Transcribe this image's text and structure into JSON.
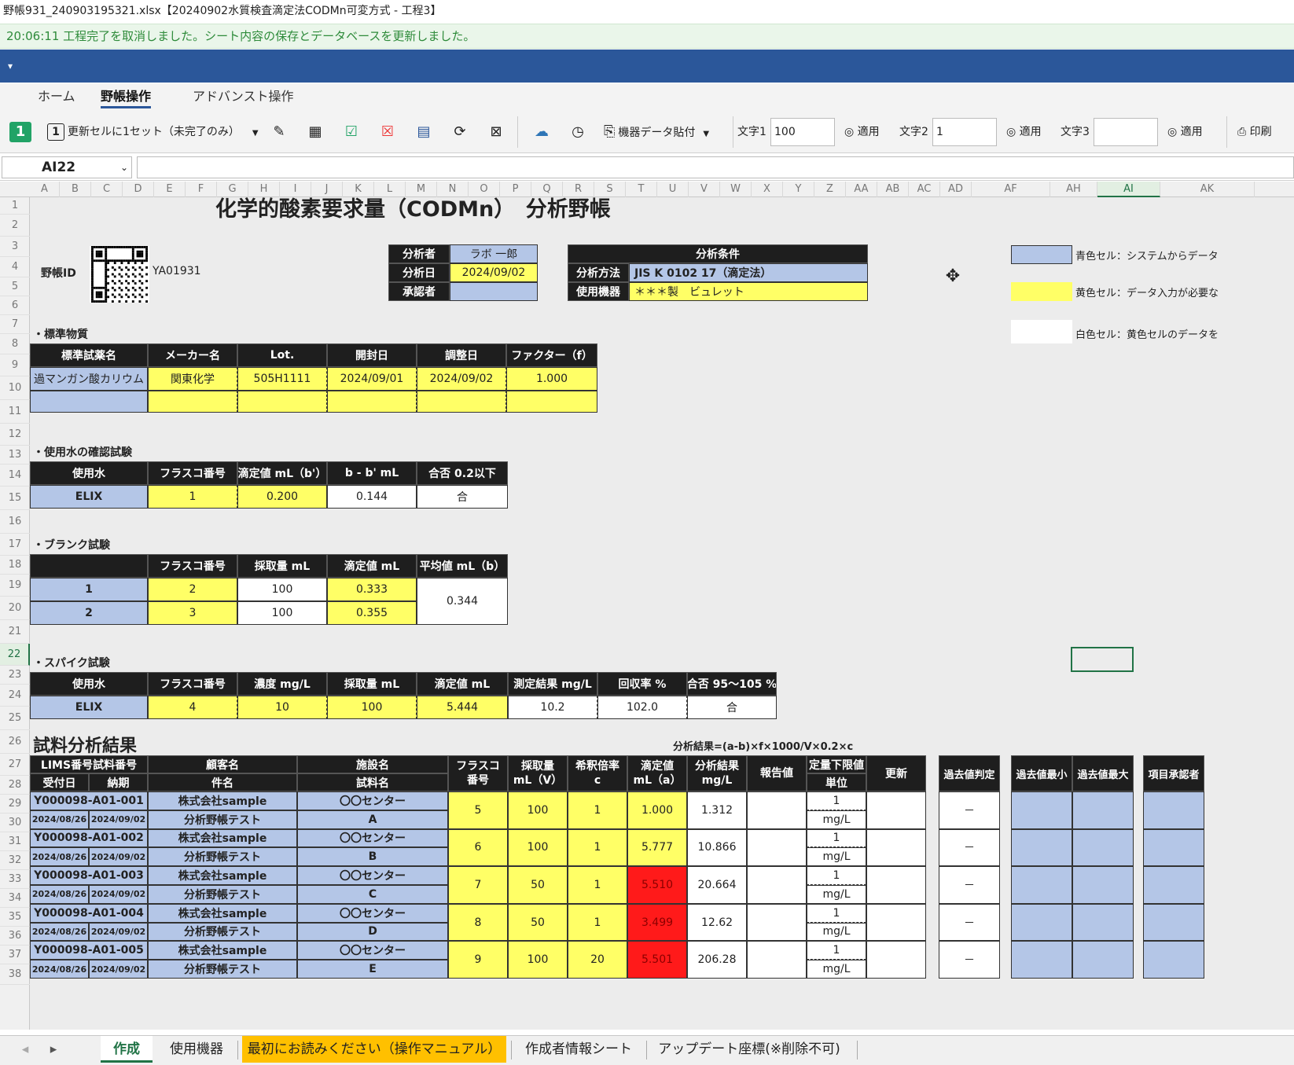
{
  "window": {
    "title": "野帳931_240903195321.xlsx【20240902水質検査滴定法CODMn可変方式 - 工程3】"
  },
  "message": "20:06:11 工程完了を取消しました。シート内容の保存とデータベースを更新しました。",
  "collapse_glyph": "▾",
  "ribbon": {
    "tabs": [
      "ホーム",
      "野帳操作",
      "アドバンスト操作"
    ]
  },
  "toolbar": {
    "counter": "1",
    "update_set": "更新セルに1セット（未完了のみ）",
    "device_paste": "機器データ貼付",
    "text1_label": "文字1",
    "text1_value": "100",
    "text2_label": "文字2",
    "text2_value": "1",
    "text3_label": "文字3",
    "text3_value": "",
    "apply": "適用",
    "print": "印刷"
  },
  "namebox": "AI22",
  "columns": [
    "A",
    "B",
    "C",
    "D",
    "E",
    "F",
    "G",
    "H",
    "I",
    "J",
    "K",
    "L",
    "M",
    "N",
    "O",
    "P",
    "Q",
    "R",
    "S",
    "T",
    "U",
    "V",
    "W",
    "X",
    "Y",
    "Z",
    "AA",
    "AB",
    "AC",
    "AD",
    "AF",
    "AH",
    "AI",
    "AK"
  ],
  "sheet": {
    "title": "化学的酸素要求量（CODMn）　分析野帳",
    "notebook_id_label": "野帳ID",
    "notebook_id": "YA01931",
    "analyst": {
      "label": "分析者",
      "value": "ラボ 一郎"
    },
    "date": {
      "label": "分析日",
      "value": "2024/09/02"
    },
    "approver": {
      "label": "承認者",
      "value": ""
    },
    "conditions": {
      "header": "分析条件",
      "method_label": "分析方法",
      "method": "JIS K 0102 17（滴定法）",
      "device_label": "使用機器",
      "device": "＊＊＊製　ビュレット"
    },
    "legend": [
      "青色セル：システムからデータ",
      "黄色セル：データ入力が必要な",
      "白色セル：黄色セルのデータを"
    ],
    "std": {
      "section": "・標準物質",
      "headers": [
        "標準試薬名",
        "メーカー名",
        "Lot.",
        "開封日",
        "調整日",
        "ファクター（f）"
      ],
      "row": [
        "過マンガン酸カリウム",
        "関東化学",
        "505H1111",
        "2024/09/01",
        "2024/09/02",
        "1.000"
      ]
    },
    "water": {
      "section": "・使用水の確認試験",
      "headers": [
        "使用水",
        "フラスコ番号",
        "滴定値 mL（b'）",
        "b - b' mL",
        "合否 0.2以下"
      ],
      "row": [
        "ELIX",
        "1",
        "0.200",
        "0.144",
        "合"
      ]
    },
    "blank": {
      "section": "・ブランク試験",
      "headers": [
        "",
        "フラスコ番号",
        "採取量 mL",
        "滴定値 mL",
        "平均値 mL（b）"
      ],
      "rows": [
        [
          "1",
          "2",
          "100",
          "0.333"
        ],
        [
          "2",
          "3",
          "100",
          "0.355"
        ]
      ],
      "avg": "0.344"
    },
    "spike": {
      "section": "・スパイク試験",
      "headers": [
        "使用水",
        "フラスコ番号",
        "濃度 mg/L",
        "採取量 mL",
        "滴定値 mL",
        "測定結果 mg/L",
        "回収率 %",
        "合否 95～105 %"
      ],
      "row": [
        "ELIX",
        "4",
        "10",
        "100",
        "5.444",
        "10.2",
        "102.0",
        "合"
      ]
    },
    "results": {
      "section": "試料分析結果",
      "formula": "分析結果=(a-b)×f×1000/V×0.2×c",
      "h": {
        "lims": "LIMS番号試料番号",
        "recv": "受付日",
        "due": "納期",
        "client": "顧客名",
        "subject": "件名",
        "facility": "施設名",
        "sample": "試料名",
        "flask": "フラスコ\n番号",
        "vol": "採取量\nmL（V）",
        "dil": "希釈倍率\nc",
        "tit": "滴定値\nmL（a）",
        "res": "分析結果\nmg/L",
        "rep": "報告値",
        "lim": "定量下限値",
        "unit": "単位",
        "upd": "更新",
        "past": "過去値判定",
        "pmin": "過去値最小",
        "pmax": "過去値最大",
        "appr": "項目承認者"
      },
      "rows": [
        {
          "lims": "Y000098-A01-001",
          "recv": "2024/08/26",
          "due": "2024/09/02",
          "client": "株式会社sample",
          "subject": "分析野帳テスト",
          "facility": "〇〇センター",
          "sample": "A",
          "flask": "5",
          "vol": "100",
          "dil": "1",
          "tit": "1.000",
          "res": "1.312",
          "lim": "1",
          "unit": "mg/L",
          "past": "－",
          "red": false
        },
        {
          "lims": "Y000098-A01-002",
          "recv": "2024/08/26",
          "due": "2024/09/02",
          "client": "株式会社sample",
          "subject": "分析野帳テスト",
          "facility": "〇〇センター",
          "sample": "B",
          "flask": "6",
          "vol": "100",
          "dil": "1",
          "tit": "5.777",
          "res": "10.866",
          "lim": "1",
          "unit": "mg/L",
          "past": "－",
          "red": false
        },
        {
          "lims": "Y000098-A01-003",
          "recv": "2024/08/26",
          "due": "2024/09/02",
          "client": "株式会社sample",
          "subject": "分析野帳テスト",
          "facility": "〇〇センター",
          "sample": "C",
          "flask": "7",
          "vol": "50",
          "dil": "1",
          "tit": "5.510",
          "res": "20.664",
          "lim": "1",
          "unit": "mg/L",
          "past": "－",
          "red": true
        },
        {
          "lims": "Y000098-A01-004",
          "recv": "2024/08/26",
          "due": "2024/09/02",
          "client": "株式会社sample",
          "subject": "分析野帳テスト",
          "facility": "〇〇センター",
          "sample": "D",
          "flask": "8",
          "vol": "50",
          "dil": "1",
          "tit": "3.499",
          "res": "12.62",
          "lim": "1",
          "unit": "mg/L",
          "past": "－",
          "red": true
        },
        {
          "lims": "Y000098-A01-005",
          "recv": "2024/08/26",
          "due": "2024/09/02",
          "client": "株式会社sample",
          "subject": "分析野帳テスト",
          "facility": "〇〇センター",
          "sample": "E",
          "flask": "9",
          "vol": "100",
          "dil": "20",
          "tit": "5.501",
          "res": "206.28",
          "lim": "1",
          "unit": "mg/L",
          "past": "－",
          "red": true
        }
      ]
    }
  },
  "sheet_tabs": [
    "作成",
    "使用機器",
    "最初にお読みください（操作マニュアル）",
    "作成者情報シート",
    "アップデート座標(※削除不可)"
  ]
}
